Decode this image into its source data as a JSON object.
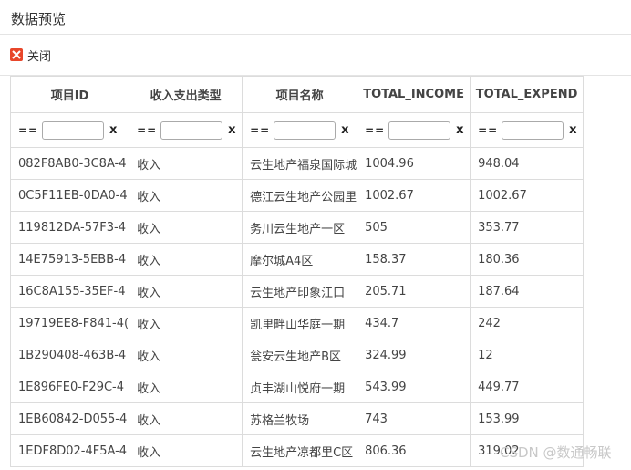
{
  "window": {
    "title": "数据预览"
  },
  "toolbar": {
    "close_label": "关闭",
    "close_icon": "close-icon"
  },
  "table": {
    "columns": [
      "项目ID",
      "收入支出类型",
      "项目名称",
      "TOTAL_INCOME",
      "TOTAL_EXPEND"
    ],
    "filter": {
      "operator": "==",
      "value": "",
      "clear": "x"
    },
    "rows": [
      [
        "082F8AB0-3C8A-4",
        "收入",
        "云生地产福泉国际城",
        "1004.96",
        "948.04"
      ],
      [
        "0C5F11EB-0DA0-4",
        "收入",
        "德江云生地产公园里",
        "1002.67",
        "1002.67"
      ],
      [
        "119812DA-57F3-4",
        "收入",
        "务川云生地产一区",
        "505",
        "353.77"
      ],
      [
        "14E75913-5EBB-4",
        "收入",
        "摩尔城A4区",
        "158.37",
        "180.36"
      ],
      [
        "16C8A155-35EF-4",
        "收入",
        "云生地产印象江口",
        "205.71",
        "187.64"
      ],
      [
        "19719EE8-F841-4(",
        "收入",
        "凯里畔山华庭一期",
        "434.7",
        "242"
      ],
      [
        "1B290408-463B-4",
        "收入",
        "瓮安云生地产B区",
        "324.99",
        "12"
      ],
      [
        "1E896FE0-F29C-4",
        "收入",
        "贞丰湖山悦府一期",
        "543.99",
        "449.77"
      ],
      [
        "1EB60842-D055-4",
        "收入",
        "苏格兰牧场",
        "743",
        "153.99"
      ],
      [
        "1EDF8D02-4F5A-4",
        "收入",
        "云生地产凉都里C区",
        "806.36",
        "319.02"
      ]
    ]
  },
  "watermark": "CSDN @数通畅联"
}
